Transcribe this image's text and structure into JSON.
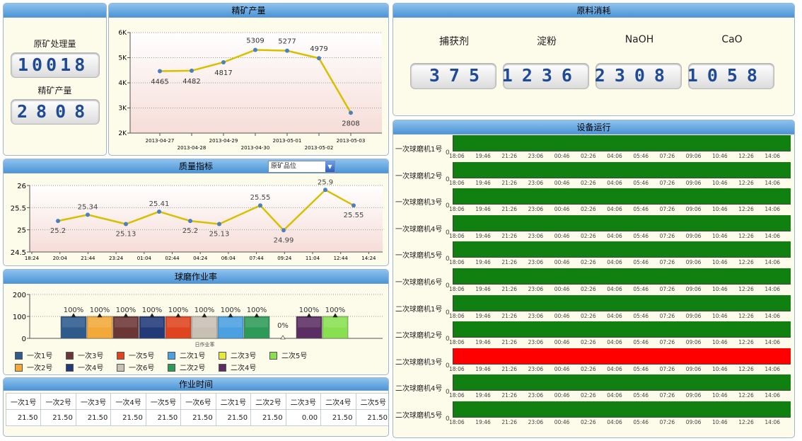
{
  "summary": {
    "raw_label": "原矿处理量",
    "raw_value": "10018",
    "conc_label": "精矿产量",
    "conc_value": "2808"
  },
  "production": {
    "title": "精矿产量",
    "chart_data": {
      "type": "line",
      "categories": [
        "2013-04-27",
        "2013-04-28",
        "2013-04-29",
        "2013-04-30",
        "2013-05-01",
        "2013-05-02",
        "2013-05-03"
      ],
      "values": [
        4465,
        4482,
        4817,
        5309,
        5277,
        4979,
        2808
      ],
      "ylim": [
        2000,
        6000
      ],
      "yticks": [
        "2K",
        "3K",
        "4K",
        "5K",
        "6K"
      ],
      "color": "#d8c000"
    }
  },
  "consumption": {
    "title": "原料消耗",
    "items": [
      {
        "label": "捕获剂",
        "value": "375"
      },
      {
        "label": "淀粉",
        "value": "1236"
      },
      {
        "label": "NaOH",
        "value": "2308"
      },
      {
        "label": "CaO",
        "value": "1058"
      }
    ]
  },
  "quality": {
    "title": "质量指标",
    "select": "原矿品位",
    "chart_data": {
      "type": "line",
      "categories": [
        "18:24",
        "20:04",
        "21:44",
        "23:24",
        "01:04",
        "02:44",
        "04:24",
        "06:04",
        "07:44",
        "09:24",
        "11:04",
        "12:44",
        "14:24"
      ],
      "x": [
        "20:04",
        "21:44",
        "23:24",
        "01:04",
        "02:44",
        "04:24",
        "06:04",
        "07:44",
        "09:24",
        "11:04",
        "12:44",
        "14:24"
      ],
      "values": [
        25.2,
        25.34,
        25.13,
        25.41,
        25.2,
        25.13,
        25.55,
        24.99,
        25.9,
        25.55
      ],
      "ylim": [
        24.5,
        26
      ],
      "yticks": [
        "24.5",
        "25",
        "25.5",
        "26"
      ],
      "color": "#d8c000"
    }
  },
  "mill_rate": {
    "title": "球磨作业率",
    "xlabel": "日作业率",
    "chart_data": {
      "type": "bar",
      "categories": [
        "一次1号",
        "一次2号",
        "一次3号",
        "一次4号",
        "一次5号",
        "一次6号",
        "二次1号",
        "二次2号",
        "二次3号",
        "二次4号",
        "二次5号"
      ],
      "values": [
        100,
        100,
        100,
        100,
        100,
        100,
        100,
        100,
        0,
        100,
        100
      ],
      "labels": [
        "100%",
        "100%",
        "100%",
        "100%",
        "100%",
        "100%",
        "100%",
        "100%",
        "0%",
        "100%",
        "100%"
      ],
      "ylim": [
        0,
        200
      ],
      "yticks": [
        "0",
        "100",
        "200"
      ],
      "colors": [
        "#2e5a8c",
        "#f2a93a",
        "#6a3636",
        "#223a78",
        "#e0441e",
        "#c9c0b4",
        "#4aa0e0",
        "#2e9a58",
        "#e8e838",
        "#5a2e62",
        "#88e050"
      ]
    },
    "legend_order": [
      0,
      2,
      4,
      6,
      8,
      10,
      1,
      3,
      5,
      7,
      9
    ]
  },
  "work_time": {
    "title": "作业时间",
    "headers": [
      "一次1号",
      "一次2号",
      "一次3号",
      "一次4号",
      "一次5号",
      "一次6号",
      "二次1号",
      "二次2号",
      "二次3号",
      "二次4号",
      "二次5号"
    ],
    "values": [
      "21.50",
      "21.50",
      "21.50",
      "21.50",
      "21.50",
      "21.50",
      "21.50",
      "21.50",
      "0.00",
      "21.50",
      "21.50"
    ]
  },
  "equipment": {
    "title": "设备运行",
    "times": [
      "18:06",
      "19:46",
      "21:26",
      "23:06",
      "00:46",
      "02:26",
      "04:06",
      "05:46",
      "07:26",
      "09:06",
      "10:46",
      "12:26",
      "14:06"
    ],
    "zero": "0",
    "running_color": "#108010",
    "stopped_color": "#ff0000",
    "items": [
      {
        "name": "一次球磨机1号",
        "status": "running"
      },
      {
        "name": "一次球磨机2号",
        "status": "running"
      },
      {
        "name": "一次球磨机3号",
        "status": "running"
      },
      {
        "name": "一次球磨机4号",
        "status": "running"
      },
      {
        "name": "一次球磨机5号",
        "status": "running"
      },
      {
        "name": "一次球磨机6号",
        "status": "running"
      },
      {
        "name": "二次球磨机1号",
        "status": "running"
      },
      {
        "name": "二次球磨机2号",
        "status": "running"
      },
      {
        "name": "二次球磨机3号",
        "status": "stopped"
      },
      {
        "name": "二次球磨机4号",
        "status": "running"
      },
      {
        "name": "二次球磨机5号",
        "status": "running"
      }
    ]
  }
}
